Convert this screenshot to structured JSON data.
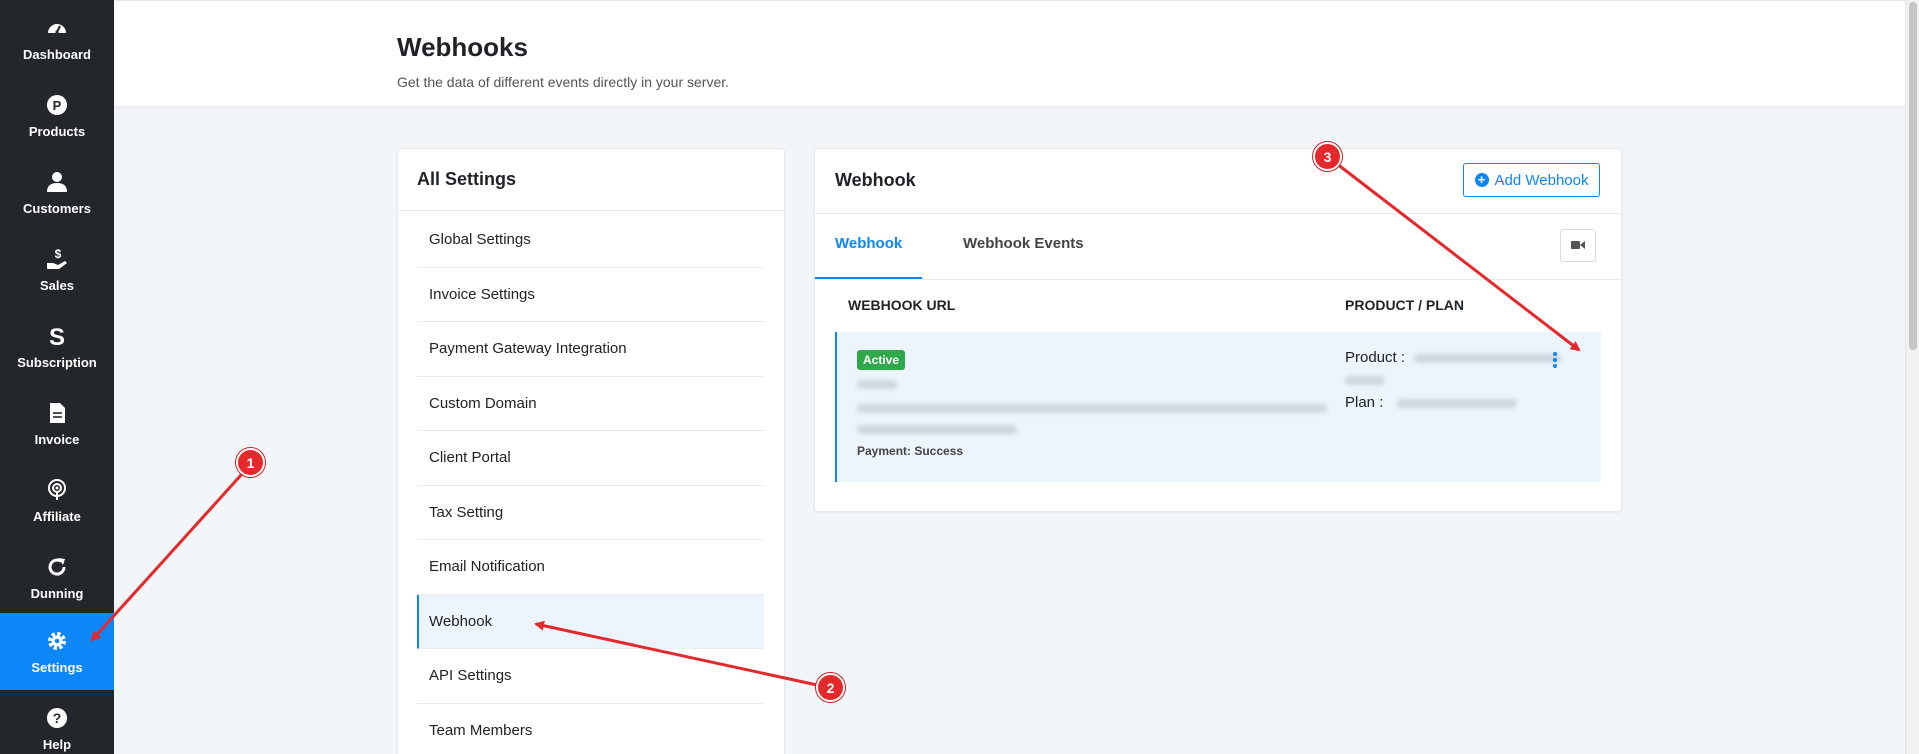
{
  "sidebar": {
    "items": [
      {
        "label": "Dashboard",
        "icon": "dashboard-icon"
      },
      {
        "label": "Products",
        "icon": "product-icon"
      },
      {
        "label": "Customers",
        "icon": "user-icon"
      },
      {
        "label": "Sales",
        "icon": "sales-icon"
      },
      {
        "label": "Subscription",
        "icon": "subscription-icon"
      },
      {
        "label": "Invoice",
        "icon": "invoice-icon"
      },
      {
        "label": "Affiliate",
        "icon": "affiliate-icon"
      },
      {
        "label": "Dunning",
        "icon": "refresh-icon"
      },
      {
        "label": "Settings",
        "icon": "gear-icon",
        "active": true
      },
      {
        "label": "Help",
        "icon": "help-icon"
      }
    ]
  },
  "header": {
    "title": "Webhooks",
    "subtitle": "Get the data of different events directly in your server."
  },
  "settings": {
    "title": "All Settings",
    "items": [
      {
        "label": "Global Settings"
      },
      {
        "label": "Invoice Settings"
      },
      {
        "label": "Payment Gateway Integration"
      },
      {
        "label": "Custom Domain"
      },
      {
        "label": "Client Portal"
      },
      {
        "label": "Tax Setting"
      },
      {
        "label": "Email Notification"
      },
      {
        "label": "Webhook",
        "active": true
      },
      {
        "label": "API Settings"
      },
      {
        "label": "Team Members"
      }
    ]
  },
  "webhook": {
    "title": "Webhook",
    "add_button": "Add Webhook",
    "tabs": [
      {
        "label": "Webhook",
        "active": true
      },
      {
        "label": "Webhook Events"
      }
    ],
    "columns": {
      "url": "WEBHOOK URL",
      "plan": "PRODUCT / PLAN"
    },
    "row": {
      "status": "Active",
      "payment_status": "Payment: Success",
      "product_label": "Product :",
      "plan_label": "Plan :"
    }
  },
  "annotations": {
    "markers": [
      "1",
      "2",
      "3"
    ]
  },
  "colors": {
    "sidebar_bg": "#23272c",
    "accent": "#0d86f7",
    "active_badge": "#2ea84a",
    "annotation": "#e5282b"
  }
}
